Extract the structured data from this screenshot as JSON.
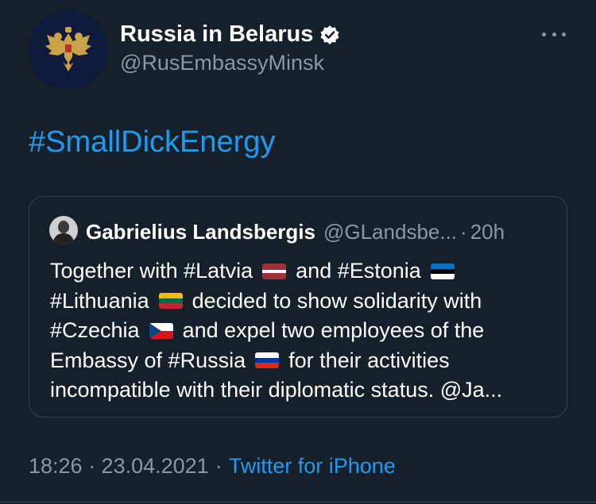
{
  "author": {
    "name": "Russia in Belarus",
    "handle": "@RusEmbassyMinsk",
    "avatar_icon": "double-headed-eagle-emblem",
    "verified_icon": "verified-badge-icon"
  },
  "tweet": {
    "text": "#SmallDickEnergy"
  },
  "quoted_tweet": {
    "name": "Gabrielius Landsbergis",
    "handle": "@GLandsbe...",
    "separator": "·",
    "time": "20h",
    "lines": [
      {
        "before": "Together with #Latvia",
        "flag1": "latvia-flag",
        "middle": "and #Estonia",
        "flag2": "estonia-flag"
      },
      {
        "before": "#Lithuania",
        "flag1": "lithuania-flag",
        "middle": "decided to show solidarity with"
      },
      {
        "before": "#Czechia",
        "flag1": "czechia-flag",
        "middle": "and expel two employees of the"
      },
      {
        "before": "Embassy of #Russia",
        "flag1": "russia-flag",
        "middle": "for their activities"
      },
      {
        "before": "incompatible with their diplomatic status. @Ja..."
      }
    ]
  },
  "footer": {
    "time": "18:26 · 23.04.2021",
    "separator": "·",
    "source": "Twitter for iPhone"
  },
  "colors": {
    "background": "#15202b",
    "accent": "#1d9bf0",
    "muted": "#8899a6",
    "border": "#38444d"
  }
}
